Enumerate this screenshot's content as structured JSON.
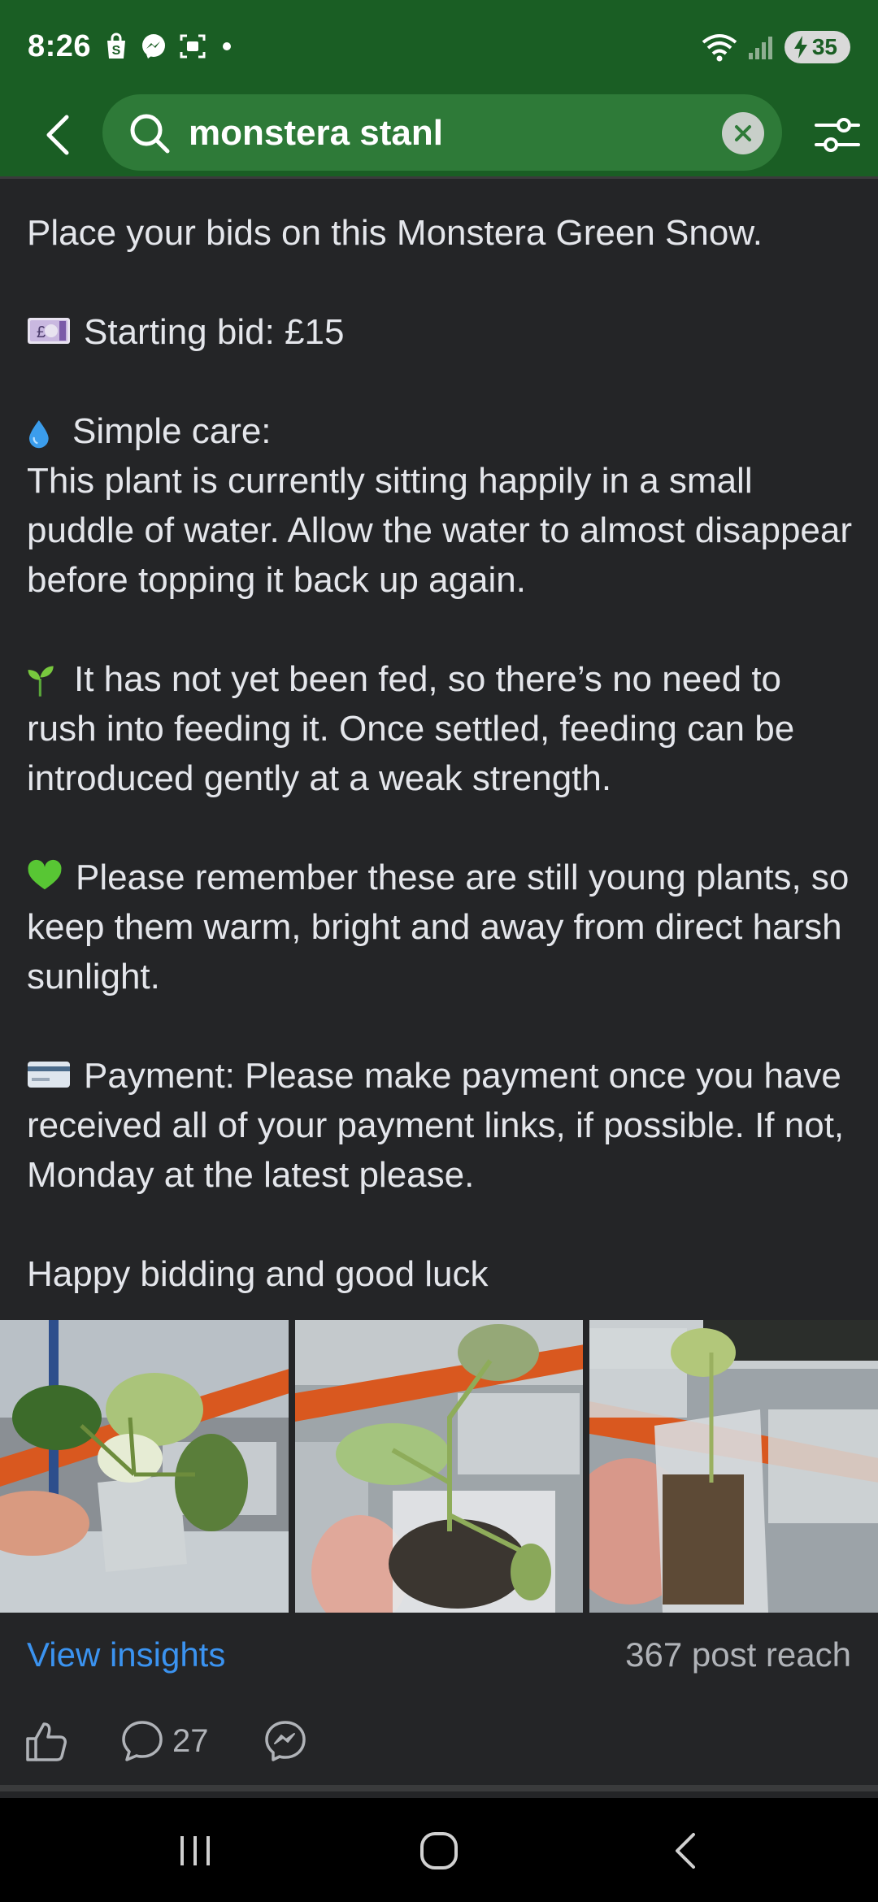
{
  "status_bar": {
    "time": "8:26",
    "battery": "35",
    "icons_left": [
      "shopping-bag-icon",
      "messenger-icon",
      "screenshot-icon",
      "dot-icon"
    ],
    "icons_right": [
      "wifi-icon",
      "signal-icon",
      "battery-icon"
    ]
  },
  "search": {
    "query": "monstera stanl"
  },
  "post": {
    "intro": "Place your bids on this Monstera Green Snow.",
    "starting_bid": "Starting bid: £15",
    "care_title": "Simple care:",
    "care_body": "This plant is currently sitting happily in a small puddle of water. Allow the water to almost disappear before topping it back up again.",
    "feeding": "It has not yet been fed, so there’s no need to rush into feeding it. Once settled, feeding can be introduced gently at a weak strength.",
    "young_plants": "Please remember these are still young plants, so keep them warm, bright and away from direct harsh sunlight.",
    "payment": "Payment: Please make payment once you have received all of your payment links, if possible. If not, Monday at the latest please.",
    "closing": "Happy bidding and good luck"
  },
  "photos": [
    "plant-photo-1",
    "plant-photo-2",
    "plant-photo-3"
  ],
  "insights": {
    "link": "View insights",
    "reach": "367 post reach"
  },
  "actions": {
    "comment_count": "27"
  },
  "colors": {
    "header_green": "#1a5e24",
    "search_green": "#2e7a38",
    "background": "#242527",
    "link_blue": "#3b93f0"
  }
}
